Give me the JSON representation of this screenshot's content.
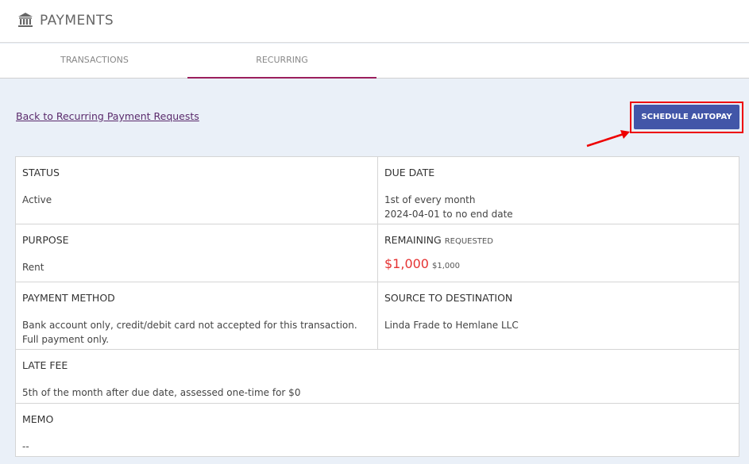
{
  "header": {
    "title": "PAYMENTS",
    "icon": "bank-icon"
  },
  "tabs": [
    {
      "label": "TRANSACTIONS"
    },
    {
      "label": "RECURRING"
    }
  ],
  "back_link": "Back to Recurring Payment Requests",
  "schedule_button": "SCHEDULE AUTOPAY",
  "details": {
    "status": {
      "label": "STATUS",
      "value": "Active"
    },
    "due_date": {
      "label": "DUE DATE",
      "line1": "1st of every month",
      "line2": "2024-04-01 to no end date"
    },
    "purpose": {
      "label": "PURPOSE",
      "value": "Rent"
    },
    "remaining": {
      "label": "REMAINING",
      "sublabel": "REQUESTED",
      "amount": "$1,000",
      "requested": "$1,000"
    },
    "payment_method": {
      "label": "PAYMENT METHOD",
      "value": "Bank account only, credit/debit card not accepted for this transaction. Full payment only."
    },
    "source_destination": {
      "label": "SOURCE TO DESTINATION",
      "value": "Linda Frade to Hemlane LLC"
    },
    "late_fee": {
      "label": "LATE FEE",
      "value": "5th of the month after due date, assessed one-time for $0"
    },
    "memo": {
      "label": "MEMO",
      "value": "--"
    }
  },
  "colors": {
    "accent_tab": "#9b1f5c",
    "button": "#4256a8",
    "highlight": "#ee0000",
    "remaining_amount": "#e53333"
  }
}
